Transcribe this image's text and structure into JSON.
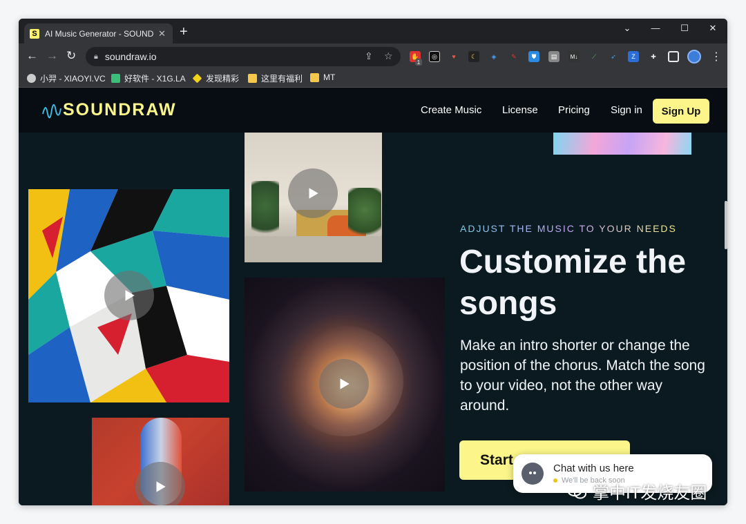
{
  "browser": {
    "tab_title": "AI Music Generator - SOUNDRAW",
    "tab_favicon": "S",
    "url": "soundraw.io",
    "bookmarks": [
      {
        "label": "小羿 - XIAOYI.VC",
        "icon": "avatar-icon"
      },
      {
        "label": "好软件 - X1G.LA",
        "icon": "app-icon"
      },
      {
        "label": "发现精彩",
        "icon": "discover-icon"
      },
      {
        "label": "这里有福利",
        "icon": "folder-icon"
      },
      {
        "label": "MT",
        "icon": "folder-icon"
      }
    ],
    "extension_badge": "1"
  },
  "site": {
    "logo": "SOUNDRAW",
    "nav": {
      "create_music": "Create Music",
      "license": "License",
      "pricing": "Pricing",
      "sign_in": "Sign in",
      "sign_up": "Sign Up"
    },
    "hero": {
      "eyebrow": "ADJUST THE MUSIC TO YOUR NEEDS",
      "headline": "Customize the songs",
      "description": "Make an intro shorter or change the position of the chorus. Match the song to your video, not the other way around.",
      "cta": "Start"
    },
    "chat": {
      "title": "Chat with us here",
      "subtitle": "We'll be back soon"
    }
  },
  "watermark": "掌中IT发烧友圈",
  "colors": {
    "accent": "#fbf58a",
    "page_bg": "#0b1a20",
    "nav_bg": "#070d12"
  }
}
